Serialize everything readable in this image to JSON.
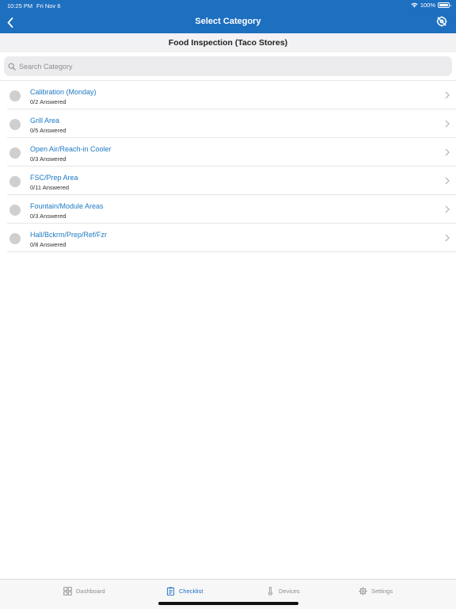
{
  "status_bar": {
    "time": "10:25 PM",
    "date": "Fri Nov 6",
    "battery": "100%"
  },
  "nav": {
    "title": "Select Category",
    "back_icon": "chevron-left-icon",
    "action_icon": "location-off-icon"
  },
  "subheader": {
    "title": "Food Inspection (Taco Stores)"
  },
  "search": {
    "placeholder": "Search Category",
    "value": ""
  },
  "categories": [
    {
      "title": "Calibration (Monday)",
      "answered": "0/2 Answered"
    },
    {
      "title": "Grill Area",
      "answered": "0/5 Answered"
    },
    {
      "title": "Open Air/Reach-in Cooler",
      "answered": "0/3 Answered"
    },
    {
      "title": "FSC/Prep Area",
      "answered": "0/11 Answered"
    },
    {
      "title": "Fountain/Module Areas",
      "answered": "0/3 Answered"
    },
    {
      "title": "Hall/Bckrm/Prep/Ref/Fzr",
      "answered": "0/8 Answered"
    }
  ],
  "tabs": [
    {
      "label": "Dashboard",
      "icon": "dashboard-icon"
    },
    {
      "label": "Checklist",
      "icon": "clipboard-icon",
      "active": true
    },
    {
      "label": "Devices",
      "icon": "thermometer-icon"
    },
    {
      "label": "Settings",
      "icon": "gear-icon"
    }
  ],
  "colors": {
    "header_bg": "#1d6fc0",
    "link": "#1d7ac4",
    "inactive_tab": "#8e8e93",
    "status_dot": "#cfcfcf"
  }
}
